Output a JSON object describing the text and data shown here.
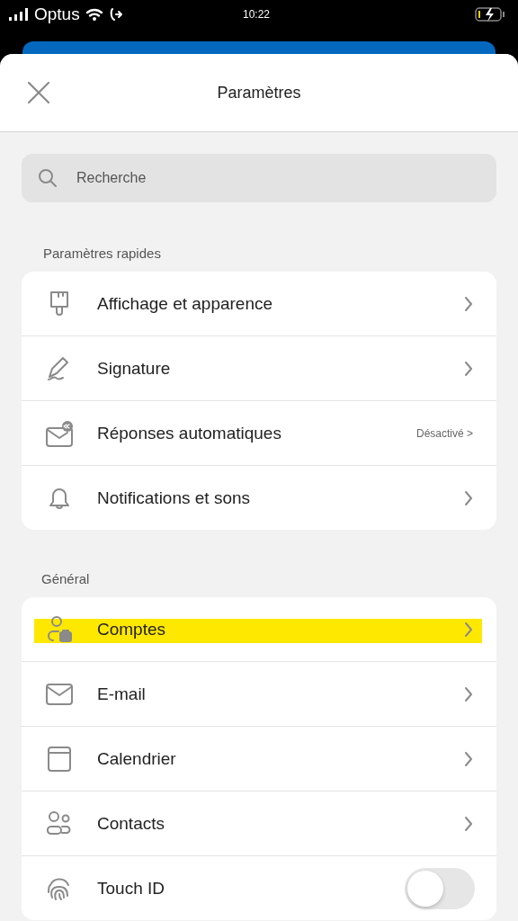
{
  "status_bar": {
    "carrier": "Optus",
    "time": "10:22"
  },
  "header": {
    "title": "Paramètres"
  },
  "search": {
    "placeholder": "Recherche"
  },
  "sections": [
    {
      "title": "Paramètres rapides",
      "items": [
        {
          "kind": "link",
          "label": "Affichage et apparence",
          "highlighted": false
        },
        {
          "kind": "link",
          "label": "Signature",
          "highlighted": false
        },
        {
          "kind": "value",
          "label": "Réponses automatiques",
          "value": "Désactivé >",
          "highlighted": false
        },
        {
          "kind": "link",
          "label": "Notifications et sons",
          "highlighted": false
        }
      ]
    },
    {
      "title": "Général",
      "items": [
        {
          "kind": "link",
          "label": "Comptes",
          "highlighted": true
        },
        {
          "kind": "link",
          "label": "E-mail",
          "highlighted": false
        },
        {
          "kind": "link",
          "label": "Calendrier",
          "highlighted": false
        },
        {
          "kind": "link",
          "label": "Contacts",
          "highlighted": false
        },
        {
          "kind": "toggle",
          "label": "Touch ID",
          "on": false,
          "highlighted": false
        }
      ]
    }
  ]
}
